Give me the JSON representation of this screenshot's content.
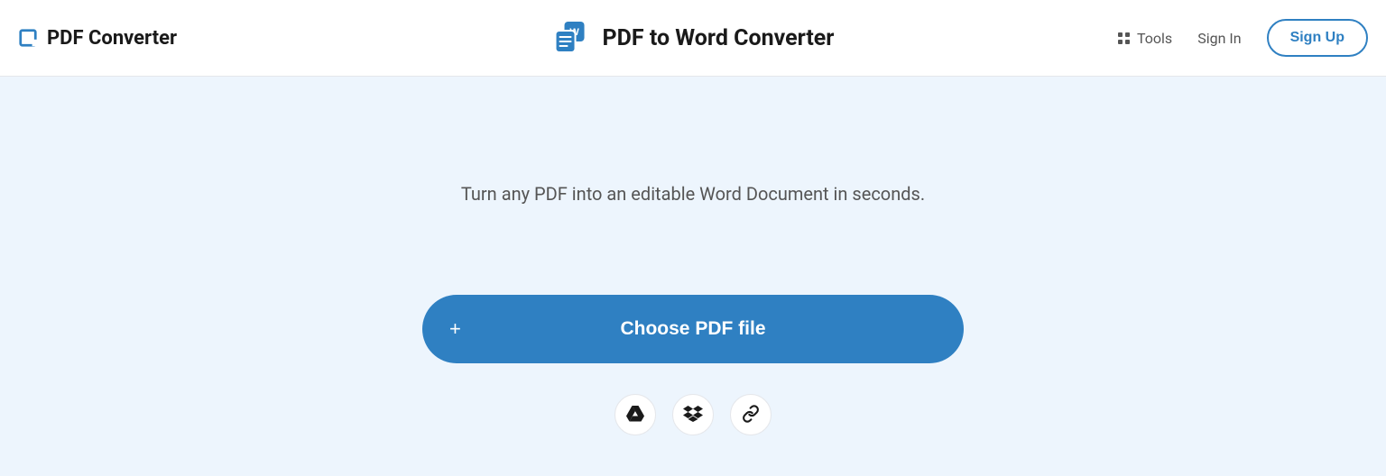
{
  "brand": {
    "name": "PDF Converter"
  },
  "page": {
    "title": "PDF to Word Converter",
    "subtitle": "Turn any PDF into an editable Word Document in seconds."
  },
  "header": {
    "tools_label": "Tools",
    "signin_label": "Sign In",
    "signup_label": "Sign Up"
  },
  "upload": {
    "choose_label": "Choose PDF file"
  },
  "colors": {
    "accent": "#2f80c2",
    "hero_bg": "#edf5fd"
  }
}
